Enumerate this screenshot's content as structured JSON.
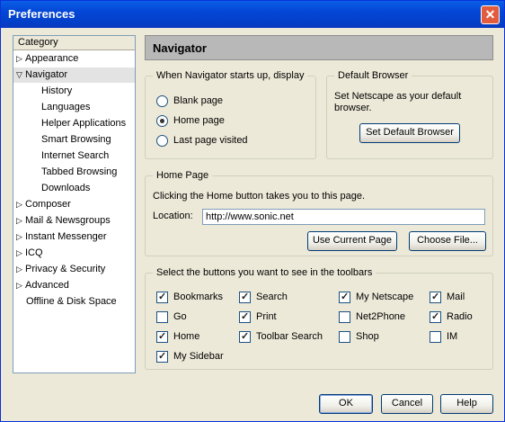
{
  "window": {
    "title": "Preferences",
    "close_icon": "close-icon"
  },
  "sidebar": {
    "header": "Category",
    "items": [
      {
        "label": "Appearance",
        "expanded": false
      },
      {
        "label": "Navigator",
        "expanded": true
      },
      {
        "label": "History"
      },
      {
        "label": "Languages"
      },
      {
        "label": "Helper Applications"
      },
      {
        "label": "Smart Browsing"
      },
      {
        "label": "Internet Search"
      },
      {
        "label": "Tabbed Browsing"
      },
      {
        "label": "Downloads"
      },
      {
        "label": "Composer",
        "expanded": false
      },
      {
        "label": "Mail & Newsgroups",
        "expanded": false
      },
      {
        "label": "Instant Messenger",
        "expanded": false
      },
      {
        "label": "ICQ",
        "expanded": false
      },
      {
        "label": "Privacy & Security",
        "expanded": false
      },
      {
        "label": "Advanced",
        "expanded": false
      },
      {
        "label": "Offline & Disk Space"
      }
    ]
  },
  "panel": {
    "title": "Navigator",
    "startup": {
      "legend": "When Navigator starts up, display",
      "options": [
        "Blank page",
        "Home page",
        "Last page visited"
      ],
      "selected": "Home page"
    },
    "default_browser": {
      "legend": "Default Browser",
      "text": "Set Netscape as your default browser.",
      "button": "Set Default Browser"
    },
    "home_page": {
      "legend": "Home Page",
      "text": "Clicking the Home button takes you to this page.",
      "location_label": "Location:",
      "location_value": "http://www.sonic.net",
      "use_current": "Use Current Page",
      "choose_file": "Choose File..."
    },
    "toolbars": {
      "legend": "Select the buttons you want to see in the toolbars",
      "items": [
        {
          "label": "Bookmarks",
          "checked": true
        },
        {
          "label": "Search",
          "checked": true
        },
        {
          "label": "My Netscape",
          "checked": true
        },
        {
          "label": "Mail",
          "checked": true
        },
        {
          "label": "Go",
          "checked": false
        },
        {
          "label": "Print",
          "checked": true
        },
        {
          "label": "Net2Phone",
          "checked": false
        },
        {
          "label": "Radio",
          "checked": true
        },
        {
          "label": "Home",
          "checked": true
        },
        {
          "label": "Toolbar Search",
          "checked": true
        },
        {
          "label": "Shop",
          "checked": false
        },
        {
          "label": "IM",
          "checked": false
        },
        {
          "label": "My Sidebar",
          "checked": true
        }
      ]
    }
  },
  "footer": {
    "ok": "OK",
    "cancel": "Cancel",
    "help": "Help"
  }
}
